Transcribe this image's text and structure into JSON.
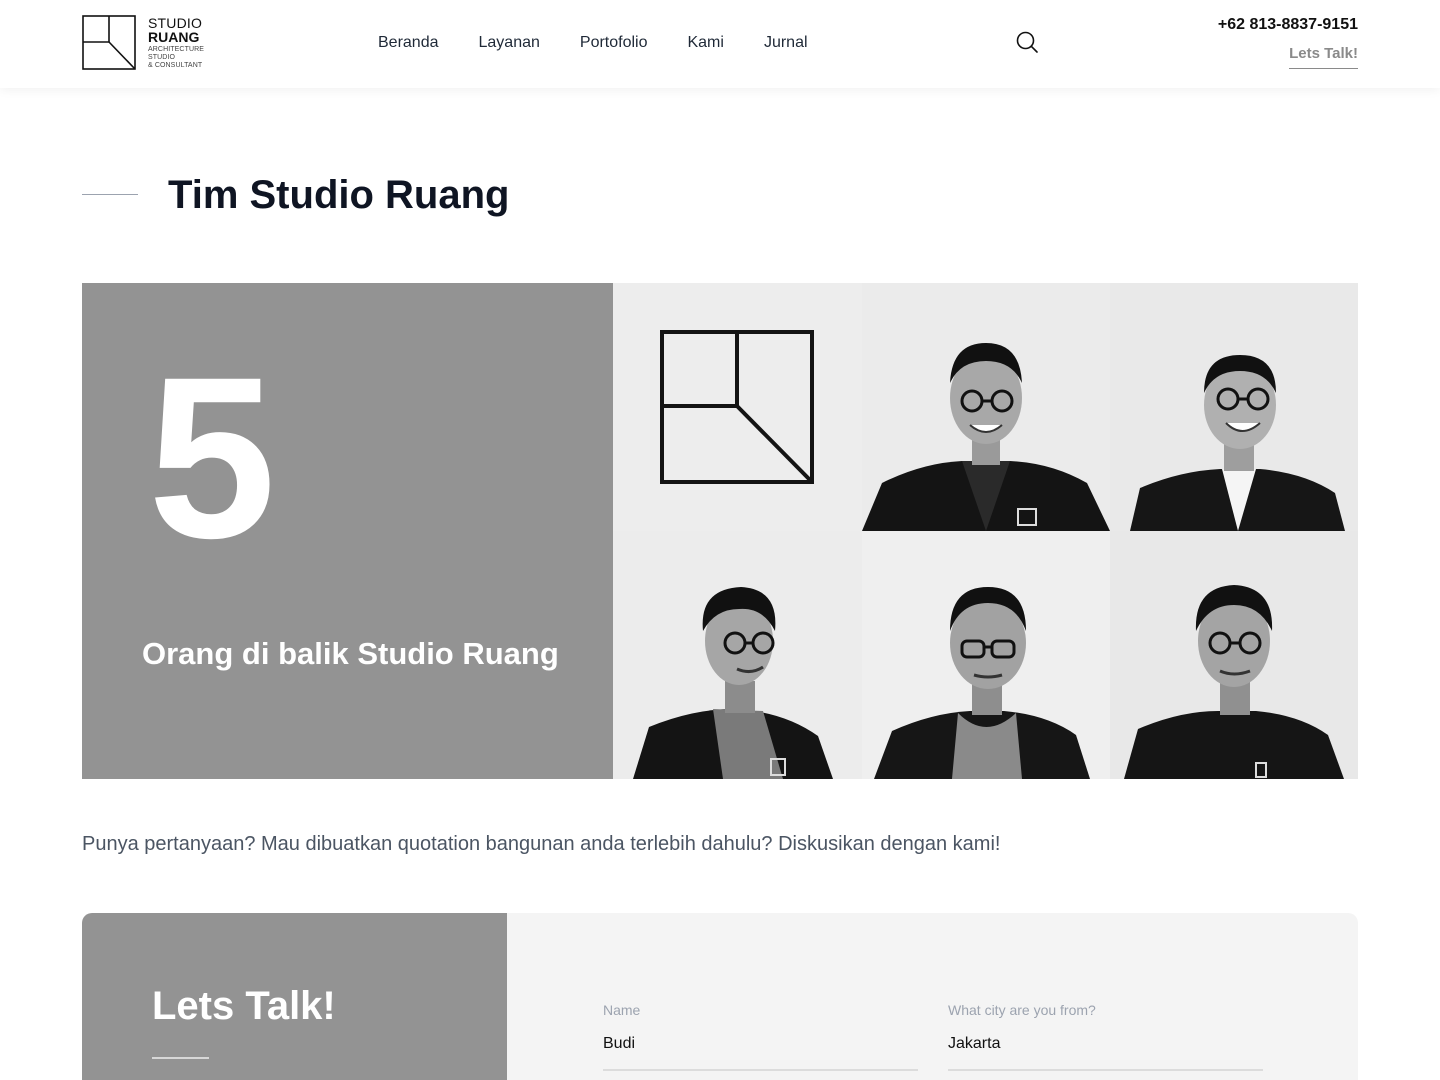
{
  "header": {
    "logo": {
      "line1": "STUDIO",
      "line2": "RUANG",
      "line3": "ARCHITECTURE",
      "line4": "STUDIO",
      "line5": "& CONSULTANT"
    },
    "nav": [
      "Beranda",
      "Layanan",
      "Portofolio",
      "Kami",
      "Jurnal"
    ],
    "search_icon": "search-icon",
    "phone": "+62 813-8837-9151",
    "cta": "Lets Talk!"
  },
  "section": {
    "title": "Tim Studio Ruang"
  },
  "team": {
    "count": "5",
    "caption": "Orang di balik Studio Ruang",
    "accent_color": "#939393",
    "photos": [
      "logo-tile",
      "member-photo",
      "member-photo",
      "member-photo",
      "member-photo",
      "member-photo"
    ]
  },
  "prompt": "Punya pertanyaan? Mau dibuatkan quotation bangunan anda terlebih dahulu? Diskusikan dengan kami!",
  "contact": {
    "title": "Lets Talk!",
    "fields": [
      {
        "label": "Name",
        "value": "Budi"
      },
      {
        "label": "What city are you from?",
        "value": "Jakarta"
      }
    ]
  }
}
